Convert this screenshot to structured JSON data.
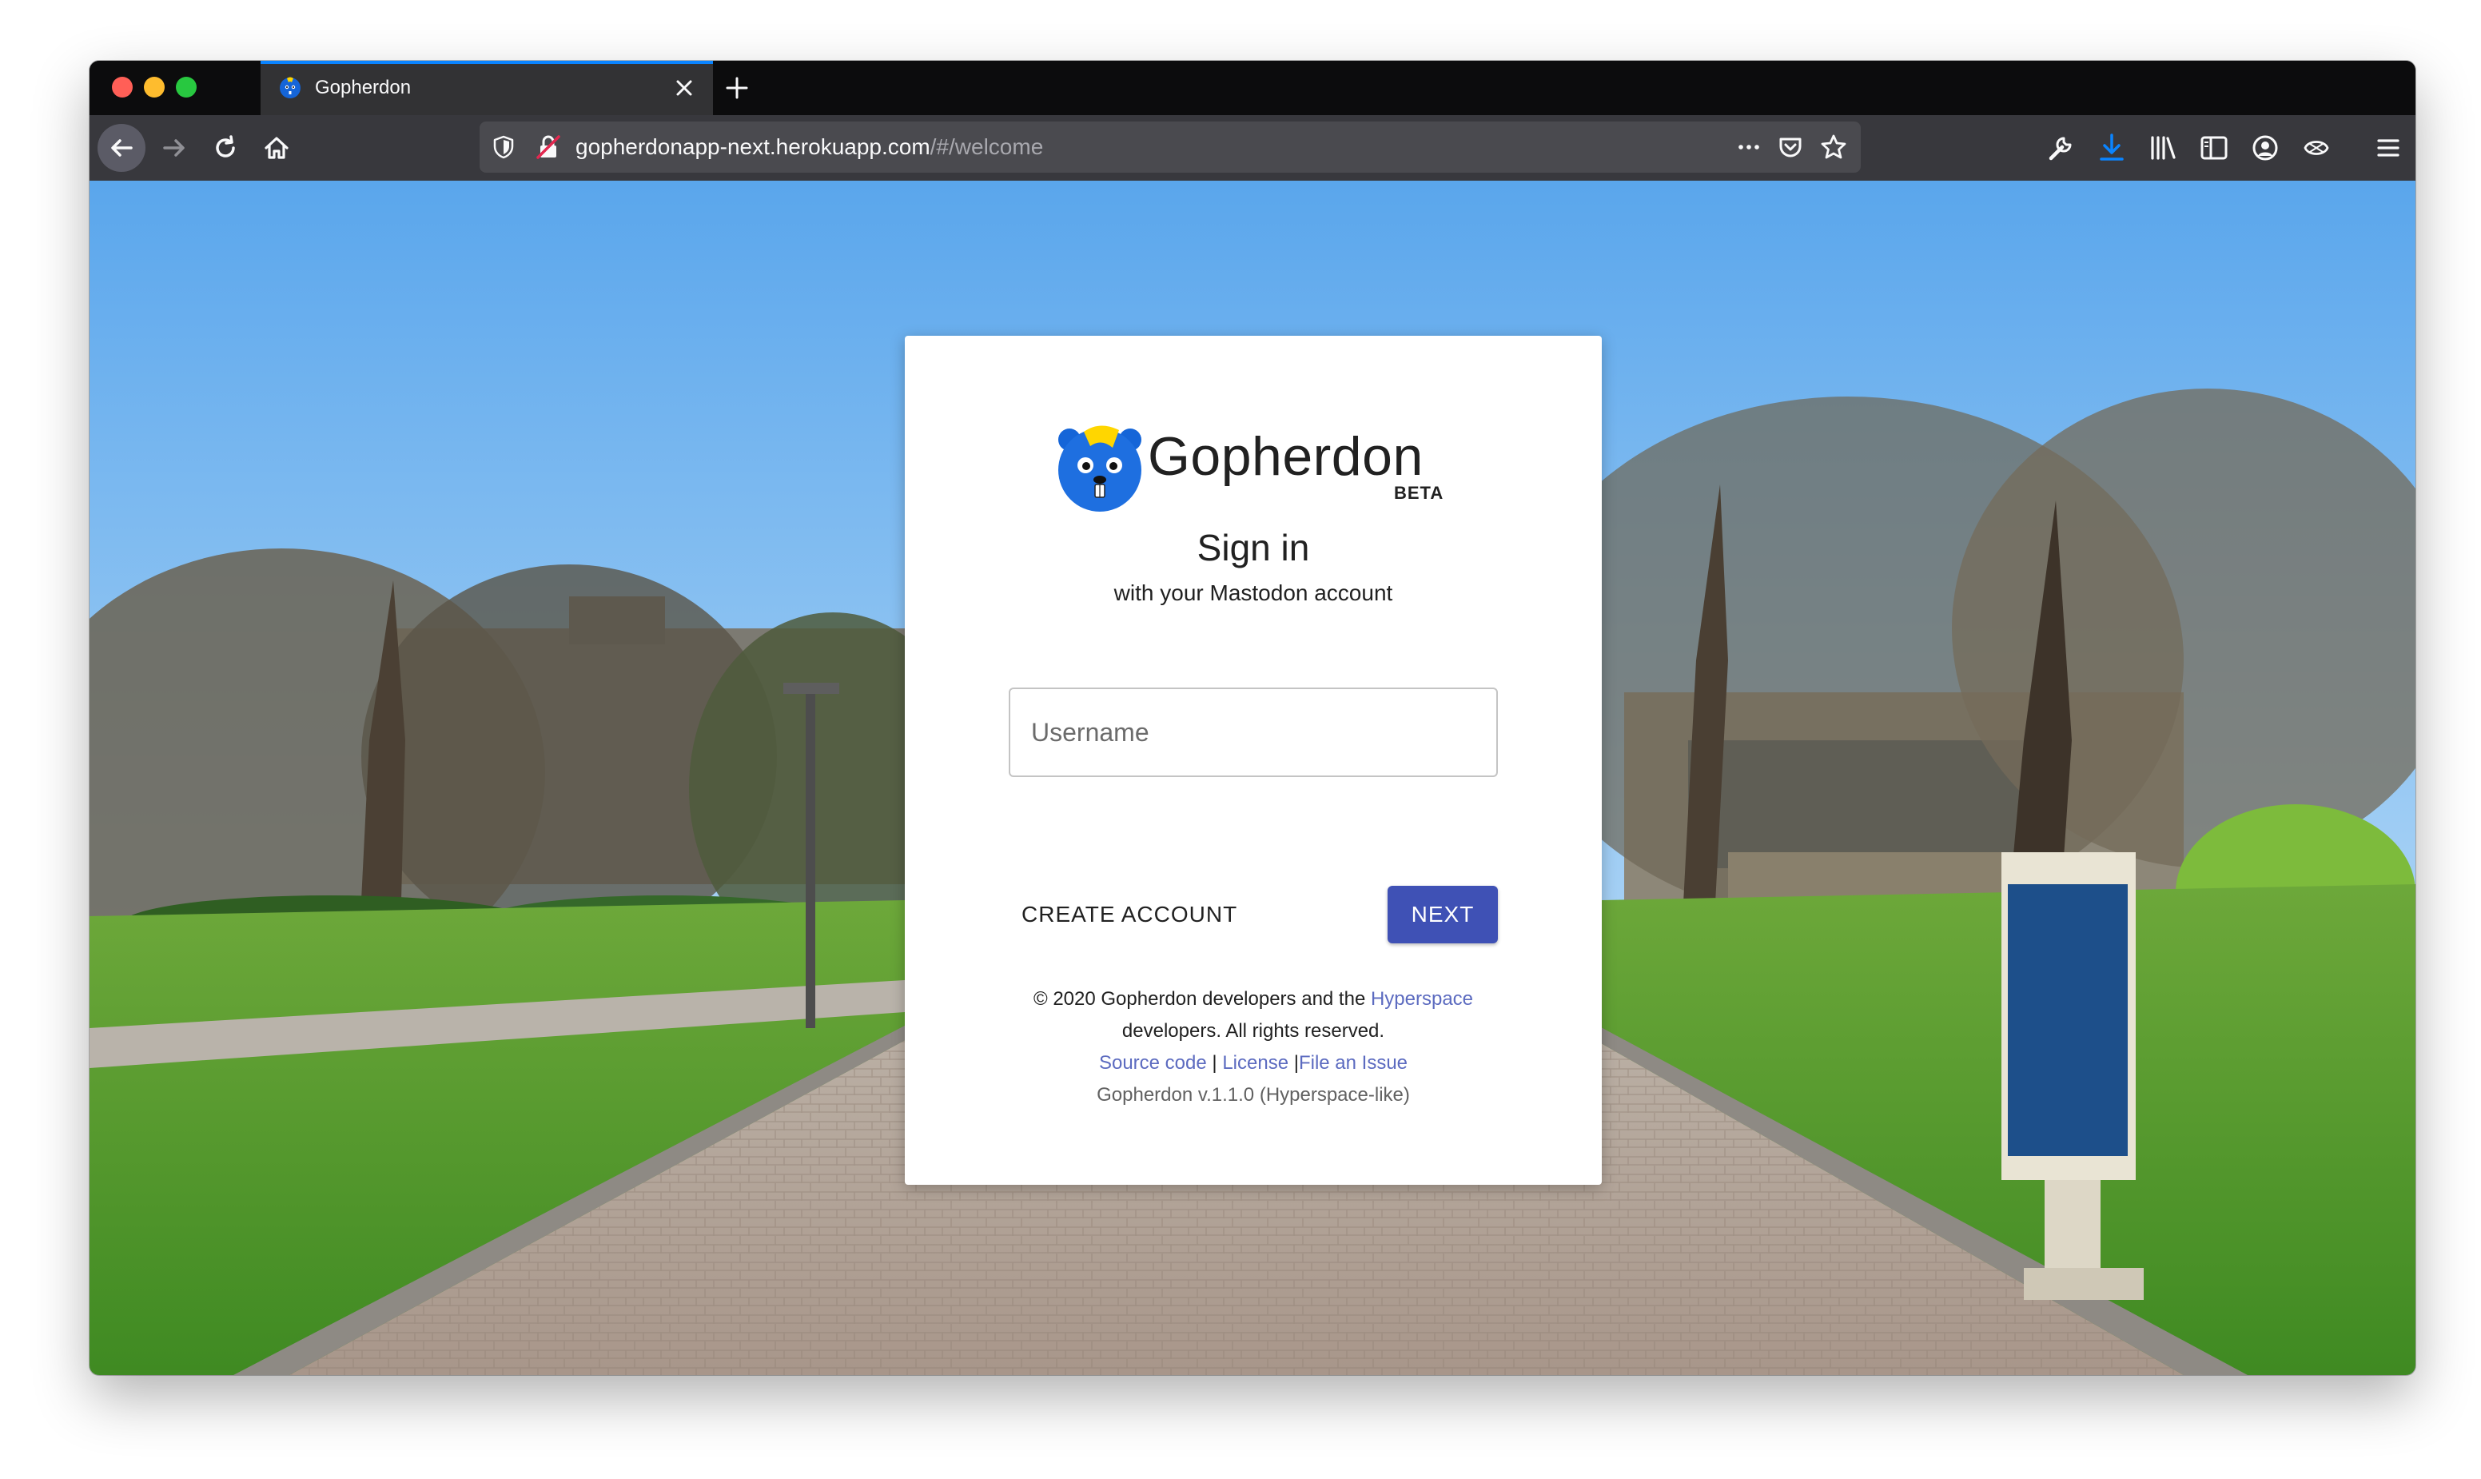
{
  "browser": {
    "tab_title": "Gopherdon",
    "url_host": "gopherdonapp-next.herokuapp.com",
    "url_path": "/#/welcome",
    "colors": {
      "tab_accent": "#0a84ff",
      "download_icon": "#0a84ff"
    },
    "icons": [
      "back-arrow-icon",
      "forward-arrow-icon",
      "reload-icon",
      "home-icon",
      "shield-icon",
      "insecure-lock-icon",
      "more-icon",
      "pocket-icon",
      "star-icon",
      "wrench-icon",
      "download-icon",
      "library-icon",
      "sidebar-icon",
      "account-icon",
      "extension-icon",
      "menu-icon"
    ]
  },
  "card": {
    "brand": "Gopherdon",
    "beta": "BETA",
    "title": "Sign in",
    "subtitle": "with your Mastodon account",
    "username_placeholder": "Username",
    "create_account_label": "CREATE ACCOUNT",
    "next_label": "NEXT",
    "colors": {
      "primary": "#3f51b5",
      "link": "#5c6bc0"
    },
    "footer": {
      "copyright_prefix": "© 2020 Gopherdon developers and the ",
      "hyperspace_link": "Hyperspace",
      "copyright_suffix": "developers. All rights reserved.",
      "source_code": "Source code",
      "separator1": " | ",
      "license": "License",
      "separator2": " |",
      "file_issue": "File an Issue",
      "version": "Gopherdon v.1.1.0 (Hyperspace-like)"
    }
  }
}
